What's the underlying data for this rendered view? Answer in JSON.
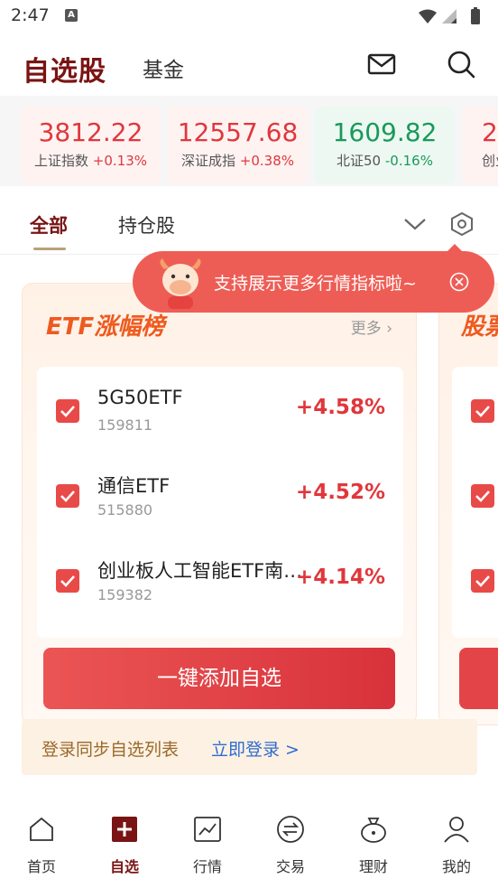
{
  "status_bar": {
    "time": "2:47",
    "notif_letter": "A"
  },
  "header": {
    "title": "自选股",
    "fund_tab": "基金"
  },
  "indices": [
    {
      "value": "3812.22",
      "name": "上证指数",
      "change": "+0.13%",
      "trend": "up"
    },
    {
      "value": "12557.68",
      "name": "深证成指",
      "change": "+0.38%",
      "trend": "up"
    },
    {
      "value": "1609.82",
      "name": "北证50",
      "change": "-0.16%",
      "trend": "down"
    },
    {
      "value": "2",
      "name": "创业",
      "change": "",
      "trend": "up"
    }
  ],
  "tabs": {
    "all": "全部",
    "holdings": "持仓股"
  },
  "tooltip": {
    "text": "支持展示更多行情指标啦~"
  },
  "card": {
    "title": "ETF涨幅榜",
    "more": "更多",
    "items": [
      {
        "name": "5G50ETF",
        "code": "159811",
        "pct": "+4.58%",
        "checked": true
      },
      {
        "name": "通信ETF",
        "code": "515880",
        "pct": "+4.52%",
        "checked": true
      },
      {
        "name": "创业板人工智能ETF南…",
        "code": "159382",
        "pct": "+4.14%",
        "checked": true
      }
    ],
    "add_button": "一键添加自选"
  },
  "card2": {
    "title_partial": "股票"
  },
  "login": {
    "text": "登录同步自选列表",
    "link": "立即登录 >"
  },
  "nav": [
    {
      "label": "首页",
      "icon": "home-icon"
    },
    {
      "label": "自选",
      "icon": "watchlist-plus-icon",
      "active": true
    },
    {
      "label": "行情",
      "icon": "market-chart-icon"
    },
    {
      "label": "交易",
      "icon": "trade-exchange-icon"
    },
    {
      "label": "理财",
      "icon": "wealth-bag-icon"
    },
    {
      "label": "我的",
      "icon": "profile-icon"
    }
  ],
  "colors": {
    "brand": "#7a1414",
    "up": "#e0373c",
    "down": "#189a5a",
    "accent_orange": "#ee5a1f"
  }
}
